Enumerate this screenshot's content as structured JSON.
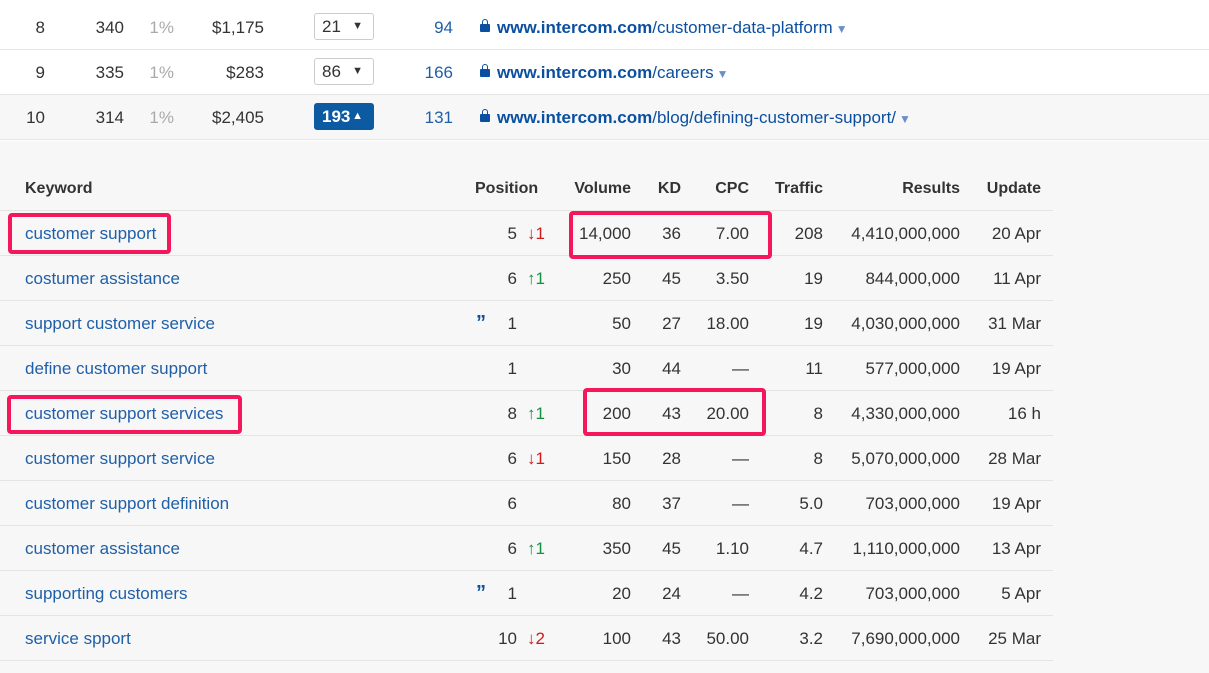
{
  "pages": [
    {
      "rank": "8",
      "keywords": "340",
      "share": "1%",
      "value": "$1,175",
      "kw_count": "21",
      "expanded": false,
      "ref": "94",
      "domain": "www.intercom.com",
      "path": "/customer-data-platform"
    },
    {
      "rank": "9",
      "keywords": "335",
      "share": "1%",
      "value": "$283",
      "kw_count": "86",
      "expanded": false,
      "ref": "166",
      "domain": "www.intercom.com",
      "path": "/careers"
    },
    {
      "rank": "10",
      "keywords": "314",
      "share": "1%",
      "value": "$2,405",
      "kw_count": "193",
      "expanded": true,
      "ref": "131",
      "domain": "www.intercom.com",
      "path": "/blog/defining-customer-support/"
    }
  ],
  "subtable": {
    "headers": {
      "keyword": "Keyword",
      "position": "Position",
      "volume": "Volume",
      "kd": "KD",
      "cpc": "CPC",
      "traffic": "Traffic",
      "results": "Results",
      "update": "Update"
    },
    "rows": [
      {
        "keyword": "customer support",
        "snippet": false,
        "position": "5",
        "change": "1",
        "dir": "down",
        "volume": "14,000",
        "kd": "36",
        "cpc": "7.00",
        "traffic": "208",
        "results": "4,410,000,000",
        "update": "20 Apr"
      },
      {
        "keyword": "costumer assistance",
        "snippet": false,
        "position": "6",
        "change": "1",
        "dir": "up",
        "volume": "250",
        "kd": "45",
        "cpc": "3.50",
        "traffic": "19",
        "results": "844,000,000",
        "update": "11 Apr"
      },
      {
        "keyword": "support customer service",
        "snippet": true,
        "position": "1",
        "change": "",
        "dir": "",
        "volume": "50",
        "kd": "27",
        "cpc": "18.00",
        "traffic": "19",
        "results": "4,030,000,000",
        "update": "31 Mar"
      },
      {
        "keyword": "define customer support",
        "snippet": false,
        "position": "1",
        "change": "",
        "dir": "",
        "volume": "30",
        "kd": "44",
        "cpc": "—",
        "traffic": "11",
        "results": "577,000,000",
        "update": "19 Apr"
      },
      {
        "keyword": "customer support services",
        "snippet": false,
        "position": "8",
        "change": "1",
        "dir": "up",
        "volume": "200",
        "kd": "43",
        "cpc": "20.00",
        "traffic": "8",
        "results": "4,330,000,000",
        "update": "16 h"
      },
      {
        "keyword": "customer support service",
        "snippet": false,
        "position": "6",
        "change": "1",
        "dir": "down",
        "volume": "150",
        "kd": "28",
        "cpc": "—",
        "traffic": "8",
        "results": "5,070,000,000",
        "update": "28 Mar"
      },
      {
        "keyword": "customer support definition",
        "snippet": false,
        "position": "6",
        "change": "",
        "dir": "",
        "volume": "80",
        "kd": "37",
        "cpc": "—",
        "traffic": "5.0",
        "results": "703,000,000",
        "update": "19 Apr"
      },
      {
        "keyword": "customer assistance",
        "snippet": false,
        "position": "6",
        "change": "1",
        "dir": "up",
        "volume": "350",
        "kd": "45",
        "cpc": "1.10",
        "traffic": "4.7",
        "results": "1,110,000,000",
        "update": "13 Apr"
      },
      {
        "keyword": "supporting customers",
        "snippet": true,
        "position": "1",
        "change": "",
        "dir": "",
        "volume": "20",
        "kd": "24",
        "cpc": "—",
        "traffic": "4.2",
        "results": "703,000,000",
        "update": "5 Apr"
      },
      {
        "keyword": "service spport",
        "snippet": false,
        "position": "10",
        "change": "2",
        "dir": "down",
        "volume": "100",
        "kd": "43",
        "cpc": "50.00",
        "traffic": "3.2",
        "results": "7,690,000,000",
        "update": "25 Mar"
      }
    ]
  },
  "highlight_color": "#f5175c"
}
